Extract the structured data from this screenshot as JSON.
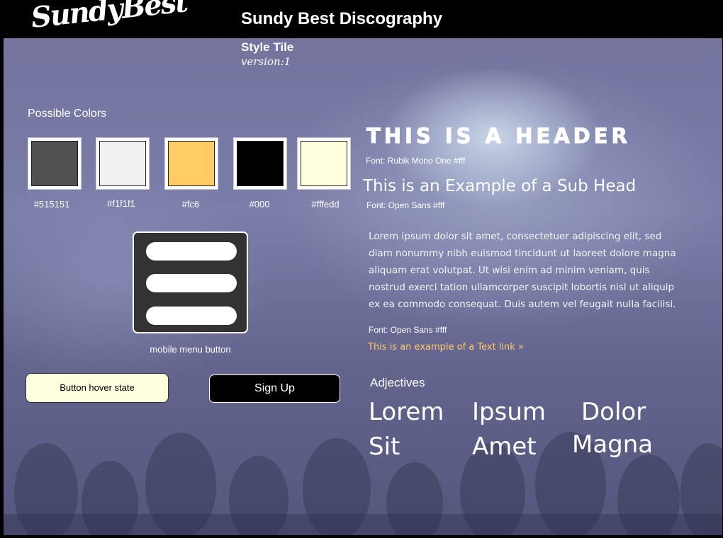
{
  "header": {
    "logo_text": "SundyBest",
    "site_title": "Sundy Best Discography"
  },
  "tile": {
    "label": "Style Tile",
    "version": "version:1"
  },
  "colors": {
    "title": "Possible Colors",
    "swatches": [
      {
        "hex": "#515151",
        "label": "#515151"
      },
      {
        "hex": "#f1f1f1",
        "label": "#f1f1f1"
      },
      {
        "hex": "#ffcc66",
        "label": "#fc6"
      },
      {
        "hex": "#000000",
        "label": "#000"
      },
      {
        "hex": "#ffffdd",
        "label": "#fffedd"
      }
    ]
  },
  "menu": {
    "caption": "mobile menu button",
    "icon": "hamburger-menu-icon"
  },
  "buttons": {
    "hover_label": "Button hover state",
    "signup_label": "Sign Up"
  },
  "typography": {
    "header": "This is a header",
    "header_font_note": "Font: Rubik Mono One #fff",
    "subhead": "This is an Example of a Sub Head",
    "subhead_font_note": "Font: Open Sans #fff",
    "body": "Lorem ipsum dolor sit amet, consectetuer adipiscing elit, sed diam nonummy nibh euismod tincidunt ut laoreet dolore magna aliquam erat volutpat. Ut wisi enim ad minim veniam, quis nostrud exerci tation ullamcorper suscipit lobortis nisl ut aliquip ex ea commodo consequat. Duis autem vel feugait nulla facilisi.",
    "body_font_note": "Font: Open Sans #fff",
    "link_text": "This is an example of a Text link »",
    "link_color": "#ffcc66"
  },
  "adjectives": {
    "title": "Adjectives",
    "words": [
      "Lorem",
      "Ipsum",
      "Dolor",
      "Sit",
      "Amet",
      "Magna"
    ]
  }
}
